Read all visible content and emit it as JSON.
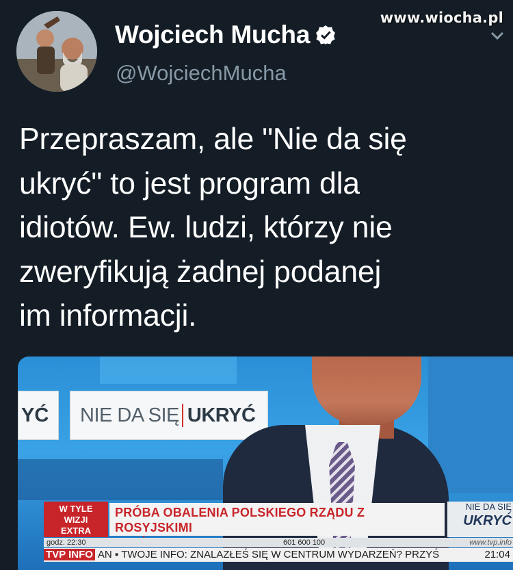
{
  "watermark": "www.wiocha.pl",
  "tweet": {
    "author_name": "Wojciech Mucha",
    "author_handle": "@WojciechMucha",
    "text": "Przepraszam, ale \"Nie da się\nukryć\" to jest program dla\nidiotów. Ew. ludzi, którzy nie\nzweryfikują żadnej podanej\nim informacji."
  },
  "media": {
    "logo_left": "YĆ",
    "logo_text_a": "NIE DA SIĘ",
    "logo_text_b": "UKRYĆ",
    "badge": "W TYLE\nWIZJI\nEXTRA",
    "headline": "PRÓBA OBALENIA POLSKIEGO RZĄDU Z ROSYJSKIMI\nSŁUŻBAMI W TLE",
    "corner_small": "NIE DA SIĘ",
    "corner_big": "UKRYĆ",
    "time_label": "godz. 22:30",
    "phone": "601 600 100",
    "site": "www.tvp.info",
    "tvp_info": "TVP INFO",
    "crawl": "AN ▪ TWOJE INFO: ZNALAZŁEŚ SIĘ W CENTRUM WYDARZEŃ? PRZYŚ",
    "clock": "21:04"
  },
  "colors": {
    "background": "#141d26",
    "handle": "#8899a6",
    "tvp_red": "#c8252a"
  }
}
